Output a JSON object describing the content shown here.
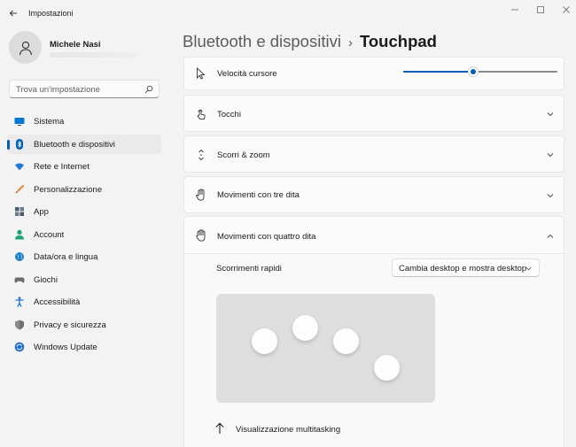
{
  "titlebar": {
    "app_title": "Impostazioni",
    "back_icon": "back-arrow-icon",
    "controls": [
      "minimize-icon",
      "maximize-icon",
      "close-icon"
    ]
  },
  "profile": {
    "name": "Michele Nasi"
  },
  "search": {
    "placeholder": "Trova un'impostazione",
    "icon": "search-icon"
  },
  "sidebar": {
    "items": [
      {
        "label": "Sistema",
        "icon": "monitor-icon",
        "color": "#0078d4"
      },
      {
        "label": "Bluetooth e dispositivi",
        "icon": "bluetooth-icon",
        "color": "#0063b1",
        "active": true
      },
      {
        "label": "Rete e Internet",
        "icon": "wifi-icon",
        "color": "#1f7ad6"
      },
      {
        "label": "Personalizzazione",
        "icon": "brush-icon",
        "color": "#e8823a"
      },
      {
        "label": "App",
        "icon": "apps-icon",
        "color": "#4a5a6a"
      },
      {
        "label": "Account",
        "icon": "account-icon",
        "color": "#1ea37a"
      },
      {
        "label": "Data/ora e lingua",
        "icon": "globe-clock-icon",
        "color": "#1e7fc6"
      },
      {
        "label": "Giochi",
        "icon": "gamepad-icon",
        "color": "#6b6b6b"
      },
      {
        "label": "Accessibilità",
        "icon": "accessibility-icon",
        "color": "#1a6fd1"
      },
      {
        "label": "Privacy e sicurezza",
        "icon": "shield-icon",
        "color": "#7a7a7a"
      },
      {
        "label": "Windows Update",
        "icon": "update-icon",
        "color": "#1c6dc9"
      }
    ]
  },
  "breadcrumb": {
    "parent": "Bluetooth e dispositivi",
    "separator": "›",
    "current": "Touchpad"
  },
  "settings": {
    "cursor_speed": {
      "label": "Velocità cursore",
      "icon": "cursor-icon",
      "value_fraction": 0.45
    },
    "taps": {
      "label": "Tocchi",
      "icon": "tap-icon"
    },
    "scroll_zoom": {
      "label": "Scorri & zoom",
      "icon": "scroll-icon"
    },
    "three_finger": {
      "label": "Movimenti con tre dita",
      "icon": "hand-icon"
    },
    "four_finger": {
      "label": "Movimenti con quattro dita",
      "icon": "hand-icon",
      "expanded": true,
      "swipes_label": "Scorrimenti rapidi",
      "swipes_value": "Cambia desktop e mostra desktop",
      "gesture_direction_label": "Visualizzazione multitasking",
      "gesture_direction_icon": "arrow-up-icon"
    }
  },
  "colors": {
    "accent": "#005fb8",
    "background": "#f3f3f3",
    "card": "#fbfbfb"
  }
}
